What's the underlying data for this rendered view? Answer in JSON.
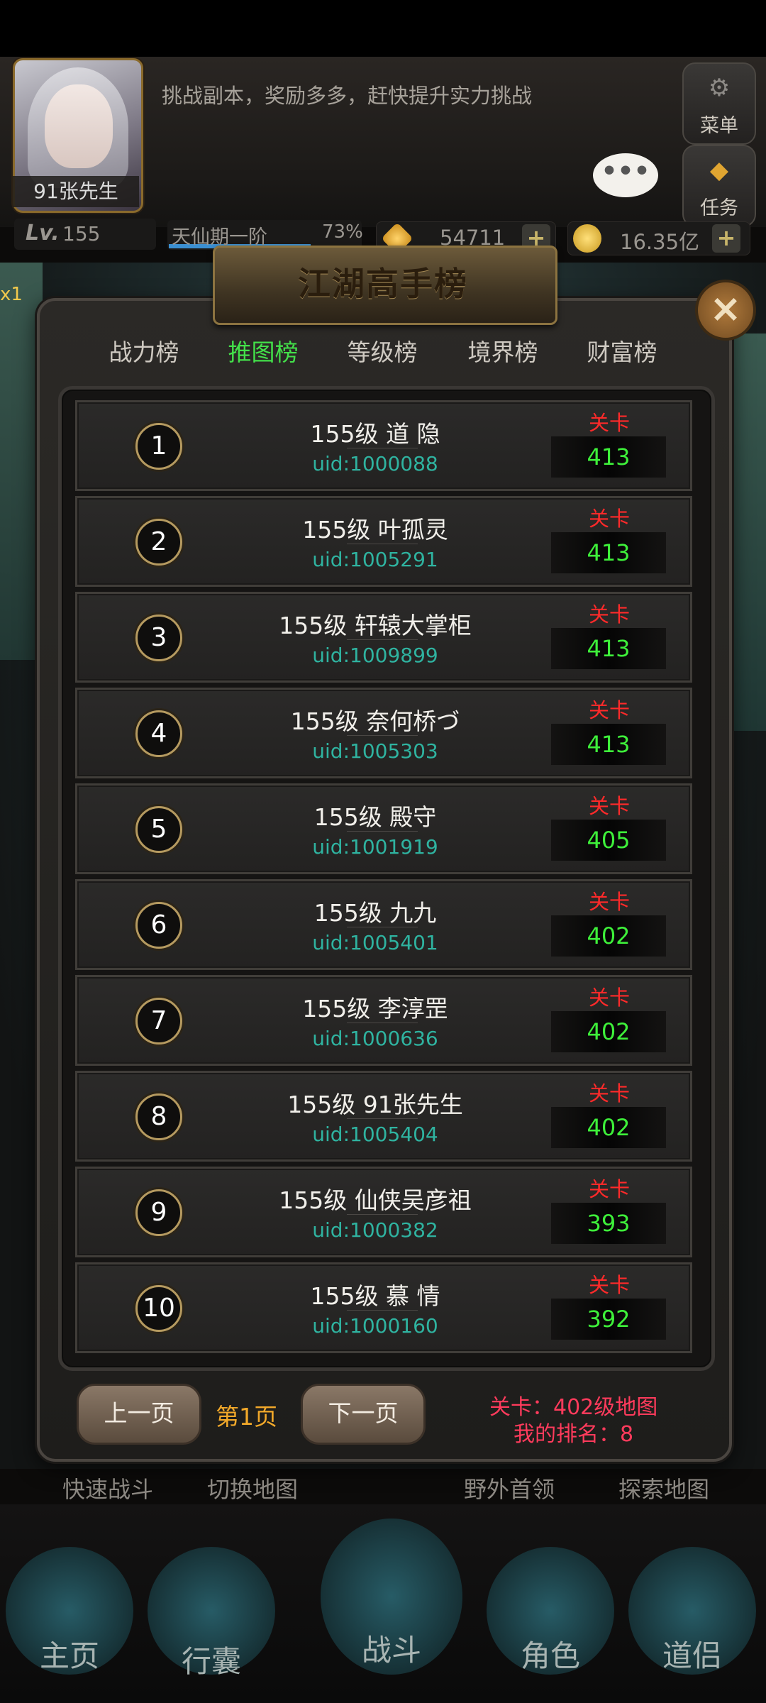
{
  "header": {
    "avatar_name": "91张先生",
    "notice": "挑战副本，奖励多多，赶快提升实力挑战",
    "menu_label": "菜单",
    "task_label": "任务",
    "chat_icon": "•••"
  },
  "stats": {
    "lv_label": "Lv.",
    "level": "155",
    "realm": "天仙期一阶",
    "realm_progress": "73%",
    "gems": "54711",
    "gold": "16.35亿",
    "plus": "+"
  },
  "bg": {
    "x1": "x1"
  },
  "modal": {
    "title": "江湖高手榜",
    "close": "×",
    "tabs": [
      "战力榜",
      "推图榜",
      "等级榜",
      "境界榜",
      "财富榜"
    ],
    "active_tab": 1,
    "stage_label": "关卡",
    "rows": [
      {
        "rank": "1",
        "name": "155级 道 隐",
        "uid": "uid:1000088",
        "stage": "413"
      },
      {
        "rank": "2",
        "name": "155级 叶孤灵",
        "uid": "uid:1005291",
        "stage": "413"
      },
      {
        "rank": "3",
        "name": "155级 轩辕大掌柜",
        "uid": "uid:1009899",
        "stage": "413"
      },
      {
        "rank": "4",
        "name": "155级 奈何桥づ",
        "uid": "uid:1005303",
        "stage": "413"
      },
      {
        "rank": "5",
        "name": "155级 殿守",
        "uid": "uid:1001919",
        "stage": "405"
      },
      {
        "rank": "6",
        "name": "155级 九九",
        "uid": "uid:1005401",
        "stage": "402"
      },
      {
        "rank": "7",
        "name": "155级 李淳罡",
        "uid": "uid:1000636",
        "stage": "402"
      },
      {
        "rank": "8",
        "name": "155级 91张先生",
        "uid": "uid:1005404",
        "stage": "402"
      },
      {
        "rank": "9",
        "name": "155级 仙侠吴彦祖",
        "uid": "uid:1000382",
        "stage": "393"
      },
      {
        "rank": "10",
        "name": "155级 慕 情",
        "uid": "uid:1000160",
        "stage": "392"
      }
    ],
    "prev_page": "上一页",
    "page_num": "第1页",
    "next_page": "下一页",
    "my_stage": "关卡：402级地图",
    "my_rank": "我的排名：8"
  },
  "sub_nav": [
    "快速战斗",
    "切换地图",
    "野外首领",
    "探索地图"
  ],
  "bottom_nav": [
    "主页",
    "行囊",
    "战斗",
    "角色",
    "道侣"
  ],
  "colors": {
    "active_tab": "#43e04a",
    "uid": "#2fb3a0",
    "stage_label": "#ff2a2a",
    "stage_value": "#3ef03a",
    "page_num": "#f2a92a",
    "my_info": "#ff3b5c"
  }
}
